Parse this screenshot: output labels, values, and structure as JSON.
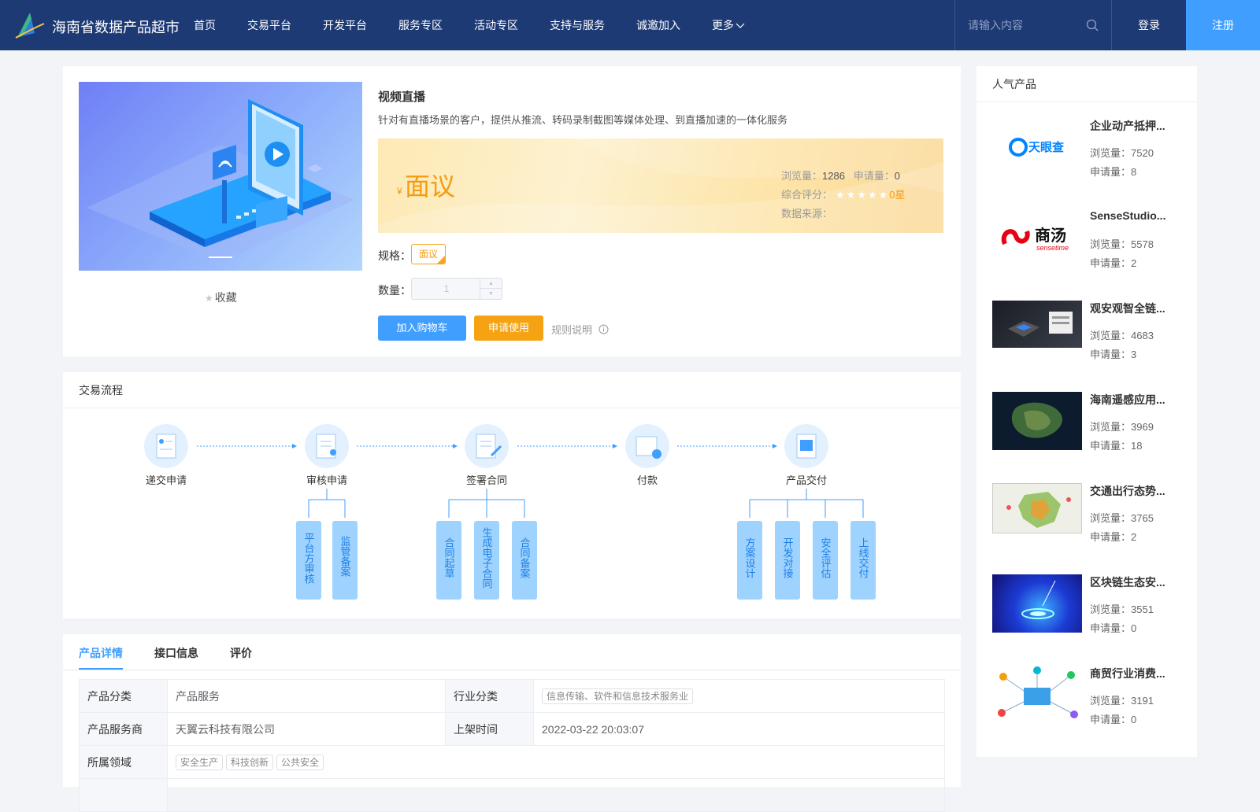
{
  "header": {
    "site_title": "海南省数据产品超市",
    "nav": [
      "首页",
      "交易平台",
      "开发平台",
      "服务专区",
      "活动专区",
      "支持与服务",
      "诚邀加入",
      "更多"
    ],
    "search_placeholder": "请输入内容",
    "login": "登录",
    "register": "注册",
    "colors": {
      "bar": "#1d3a74",
      "register": "#409eff"
    }
  },
  "product": {
    "title": "视频直播",
    "description": "针对有直播场景的客户，提供从推流、转码录制截图等媒体处理、到直播加速的一体化服务",
    "currency": "¥",
    "price": "面议",
    "views_label": "浏览量：",
    "views": "1286",
    "applies_label": "申请量：",
    "applies": "0",
    "rating_label": "综合评分：",
    "rating_stars": 0,
    "rating_text": "0星",
    "source_label": "数据来源：",
    "spec_label": "规格：",
    "spec_value": "面议",
    "qty_label": "数量：",
    "qty_value": "1",
    "favorite": "收藏",
    "add_cart": "加入购物车",
    "apply": "申请使用",
    "rules": "规则说明"
  },
  "flow": {
    "title": "交易流程",
    "steps": [
      "递交申请",
      "审核申请",
      "签署合同",
      "付款",
      "产品交付"
    ],
    "substeps": {
      "审核申请": [
        "平台方审核",
        "监管备案"
      ],
      "签署合同": [
        "合同起草",
        "生成电子合同",
        "合同备案"
      ],
      "产品交付": [
        "方案设计",
        "开发对接",
        "安全评估",
        "上线交付"
      ]
    }
  },
  "detail": {
    "tabs": [
      "产品详情",
      "接口信息",
      "评价"
    ],
    "active_tab": "产品详情",
    "rows": {
      "category_label": "产品分类",
      "category": "产品服务",
      "industry_label": "行业分类",
      "industry": "信息传输、软件和信息技术服务业",
      "provider_label": "产品服务商",
      "provider": "天翼云科技有限公司",
      "listed_label": "上架时间",
      "listed": "2022-03-22 20:03:07",
      "domain_label": "所属领域",
      "domains": [
        "安全生产",
        "科技创新",
        "公共安全"
      ]
    }
  },
  "sidebar": {
    "title": "人气产品",
    "views_label": "浏览量：",
    "applies_label": "申请量：",
    "items": [
      {
        "name": "企业动产抵押...",
        "views": "7520",
        "applies": "8",
        "thumb": "tianyancha-logo"
      },
      {
        "name": "SenseStudio...",
        "views": "5578",
        "applies": "2",
        "thumb": "sensetime-logo"
      },
      {
        "name": "观安观智全链...",
        "views": "4683",
        "applies": "3",
        "thumb": "dashboard-screenshot"
      },
      {
        "name": "海南遥感应用...",
        "views": "3969",
        "applies": "18",
        "thumb": "satellite-map"
      },
      {
        "name": "交通出行态势...",
        "views": "3765",
        "applies": "2",
        "thumb": "traffic-map"
      },
      {
        "name": "区块链生态安...",
        "views": "3551",
        "applies": "0",
        "thumb": "blockchain-art"
      },
      {
        "name": "商贸行业消费...",
        "views": "3191",
        "applies": "0",
        "thumb": "trade-network"
      }
    ],
    "thumb_text": {
      "tianyancha": "天眼查",
      "sensetime_cn": "商汤",
      "sensetime_en": "sensetime"
    }
  }
}
